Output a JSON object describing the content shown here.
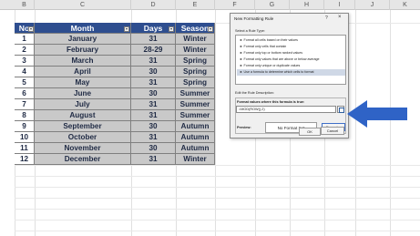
{
  "columns": [
    "B",
    "C",
    "D",
    "E",
    "F",
    "G",
    "H",
    "I",
    "J",
    "K"
  ],
  "table": {
    "headers": [
      "No",
      "Month",
      "Days",
      "Season"
    ],
    "rows": [
      [
        "1",
        "January",
        "31",
        "Winter"
      ],
      [
        "2",
        "February",
        "28-29",
        "Winter"
      ],
      [
        "3",
        "March",
        "31",
        "Spring"
      ],
      [
        "4",
        "April",
        "30",
        "Spring"
      ],
      [
        "5",
        "May",
        "31",
        "Spring"
      ],
      [
        "6",
        "June",
        "30",
        "Summer"
      ],
      [
        "7",
        "July",
        "31",
        "Summer"
      ],
      [
        "8",
        "August",
        "31",
        "Summer"
      ],
      [
        "9",
        "September",
        "30",
        "Autumn"
      ],
      [
        "10",
        "October",
        "31",
        "Autumn"
      ],
      [
        "11",
        "November",
        "30",
        "Autumn"
      ],
      [
        "12",
        "December",
        "31",
        "Winter"
      ]
    ]
  },
  "dialog": {
    "title": "New Formatting Rule",
    "help": "?",
    "close": "×",
    "select_rule_type_label": "Select a Rule Type:",
    "rule_types": [
      "► Format all cells based on their values",
      "► Format only cells that contain",
      "► Format only top or bottom ranked values",
      "► Format only values that are above or below average",
      "► Format only unique or duplicate values",
      "► Use a formula to determine which cells to format"
    ],
    "edit_description_label": "Edit the Rule Description:",
    "formula_label": "Format values where this formula is true:",
    "formula_value": "=MOD(ROW(),2)",
    "preview_label": "Preview:",
    "preview_text": "No Format Set",
    "format_button": "Format...",
    "ok_button": "OK",
    "cancel_button": "Cancel"
  },
  "colors": {
    "header_fill": "#2e4e8f",
    "selected_fill": "#c9c9c9",
    "arrow": "#2f63c6"
  }
}
